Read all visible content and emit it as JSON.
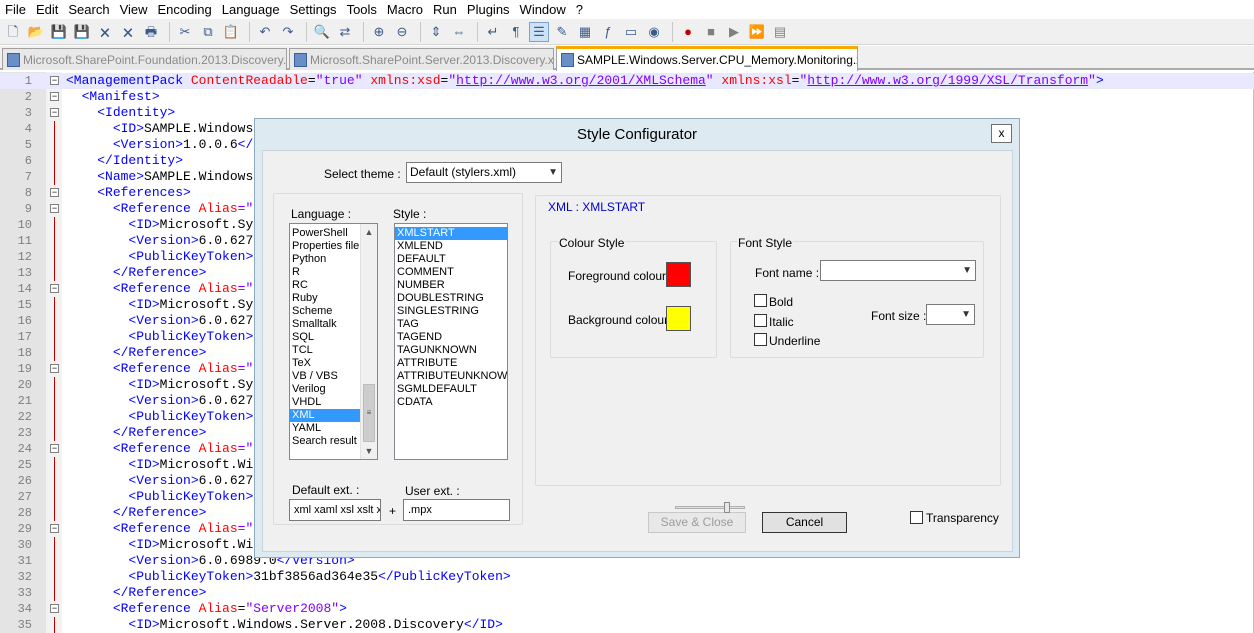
{
  "menu": [
    "File",
    "Edit",
    "Search",
    "View",
    "Encoding",
    "Language",
    "Settings",
    "Tools",
    "Macro",
    "Run",
    "Plugins",
    "Window",
    "?"
  ],
  "toolbar_icons": [
    "new-file",
    "open-file",
    "save",
    "save-all",
    "close",
    "close-all",
    "print",
    "sep",
    "cut",
    "copy",
    "paste",
    "sep",
    "undo",
    "redo",
    "sep",
    "find",
    "replace",
    "sep",
    "zoom-in",
    "zoom-out",
    "sep",
    "sync-v",
    "sync-h",
    "sep",
    "word-wrap",
    "show-all",
    "indent-guide",
    "user-lang",
    "doc-map",
    "function-list",
    "folder",
    "monitor",
    "sep",
    "record",
    "stop",
    "play",
    "play-multi",
    "save-macro"
  ],
  "tabs": [
    {
      "label": "Microsoft.SharePoint.Foundation.2013.Discovery.xml"
    },
    {
      "label": "Microsoft.SharePoint.Server.2013.Discovery.xml"
    },
    {
      "label": "SAMPLE.Windows.Server.CPU_Memory.Monitoring.xml"
    }
  ],
  "editor": {
    "lines": [
      {
        "n": "1",
        "fold": "minus"
      },
      {
        "n": "2",
        "fold": "minus"
      },
      {
        "n": "3",
        "fold": "minus"
      },
      {
        "n": "4"
      },
      {
        "n": "5"
      },
      {
        "n": "6"
      },
      {
        "n": "7"
      },
      {
        "n": "8",
        "fold": "minus"
      },
      {
        "n": "9",
        "fold": "minus"
      },
      {
        "n": "10"
      },
      {
        "n": "11"
      },
      {
        "n": "12"
      },
      {
        "n": "13"
      },
      {
        "n": "14",
        "fold": "minus"
      },
      {
        "n": "15"
      },
      {
        "n": "16"
      },
      {
        "n": "17"
      },
      {
        "n": "18"
      },
      {
        "n": "19",
        "fold": "minus"
      },
      {
        "n": "20"
      },
      {
        "n": "21"
      },
      {
        "n": "22"
      },
      {
        "n": "23"
      },
      {
        "n": "24",
        "fold": "minus"
      },
      {
        "n": "25"
      },
      {
        "n": "26"
      },
      {
        "n": "27"
      },
      {
        "n": "28"
      },
      {
        "n": "29",
        "fold": "minus"
      },
      {
        "n": "30"
      },
      {
        "n": "31"
      },
      {
        "n": "32"
      },
      {
        "n": "33"
      },
      {
        "n": "34",
        "fold": "minus"
      },
      {
        "n": "35"
      }
    ],
    "code": {
      "l1_open": "<ManagementPack",
      "l1_attr1": "ContentReadable",
      "l1_val1": "\"true\"",
      "l1_attr2": "xmlns:xsd",
      "l1_url1": "http://www.w3.org/2001/XMLSchema",
      "l1_attr3": "xmlns:xsl",
      "l1_url2": "http://www.w3.org/1999/XSL/Transform",
      "l2": "<Manifest>",
      "l3": "<Identity>",
      "l4_tag": "<ID>",
      "l4_text": "SAMPLE.Windows",
      "l5_tag": "<Version>",
      "l5_text": "1.0.0.6</",
      "l6": "</Identity>",
      "l7_tag": "<Name>",
      "l7_text": "SAMPLE.Windows",
      "l8": "<References>",
      "ref_open": "<Reference",
      "ref_alias": "Alias",
      "ref_eq": "=\"",
      "l10_tag": "<ID>",
      "l10_text": "Microsoft.Sy",
      "l11_tag": "<Version>",
      "l11_text": "6.0.627",
      "l12_tag": "<PublicKeyToken>",
      "ref_close": "</Reference>",
      "l15_tag": "<ID>",
      "l15_text": "Microsoft.Sy",
      "l16_tag": "<Version>",
      "l16_text": "6.0.627",
      "l17_tag": "<PublicKeyToken>",
      "l20_tag": "<ID>",
      "l20_text": "Microsoft.Sy",
      "l21_tag": "<Version>",
      "l21_text": "6.0.627",
      "l22_tag": "<PublicKeyToken>",
      "l25_tag": "<ID>",
      "l25_text": "Microsoft.Wi",
      "l26_tag": "<Version>",
      "l26_text": "6.0.627",
      "l27_tag": "<PublicKeyToken>",
      "l30_tag": "<ID>",
      "l30_text": "Microsoft.Wi",
      "l31_tag": "<Version>",
      "l31_text": "6.0.6989.0",
      "l31_close": "</Version>",
      "l32_tag": "<PublicKeyToken>",
      "l32_text": "31bf3856ad364e35",
      "l32_close": "</PublicKeyToken>",
      "l34_alias_val": "\"Server2008\"",
      "l34_end": ">",
      "l35_tag": "<ID>",
      "l35_text": "Microsoft.Windows.Server.2008.Discovery",
      "l35_close": "</ID>"
    }
  },
  "dialog": {
    "title": "Style Configurator",
    "close_glyph": "x",
    "select_theme_label": "Select theme :",
    "theme_value": "Default (stylers.xml)",
    "language_label": "Language :",
    "style_label": "Style :",
    "languages": [
      "PowerShell",
      "Properties file",
      "Python",
      "R",
      "RC",
      "Ruby",
      "Scheme",
      "Smalltalk",
      "SQL",
      "TCL",
      "TeX",
      "VB / VBS",
      "Verilog",
      "VHDL",
      "XML",
      "YAML",
      "Search result"
    ],
    "selected_language": "XML",
    "styles": [
      "XMLSTART",
      "XMLEND",
      "DEFAULT",
      "COMMENT",
      "NUMBER",
      "DOUBLESTRING",
      "SINGLESTRING",
      "TAG",
      "TAGEND",
      "TAGUNKNOWN",
      "ATTRIBUTE",
      "ATTRIBUTEUNKNOWN",
      "SGMLDEFAULT",
      "CDATA"
    ],
    "selected_style": "XMLSTART",
    "style_header": "XML : XMLSTART",
    "colour_style_label": "Colour Style",
    "foreground_label": "Foreground colour",
    "foreground_color": "#ff0000",
    "background_label": "Background colour",
    "background_color": "#ffff00",
    "font_style_label": "Font Style",
    "font_name_label": "Font name :",
    "font_name_value": "",
    "font_size_label": "Font size :",
    "font_size_value": "",
    "bold_label": "Bold",
    "italic_label": "Italic",
    "underline_label": "Underline",
    "default_ext_label": "Default ext. :",
    "default_ext_value": "xml xaml xsl xslt x",
    "plus": "+",
    "user_ext_label": "User ext. :",
    "user_ext_value": ".mpx",
    "save_close_label": "Save & Close",
    "cancel_label": "Cancel",
    "transparency_label": "Transparency"
  },
  "colors": {
    "tag": "#0000ff",
    "attr": "#ff0000",
    "value": "#8000ff",
    "active_tab_accent": "#f9a800",
    "selection": "#3399ff"
  }
}
